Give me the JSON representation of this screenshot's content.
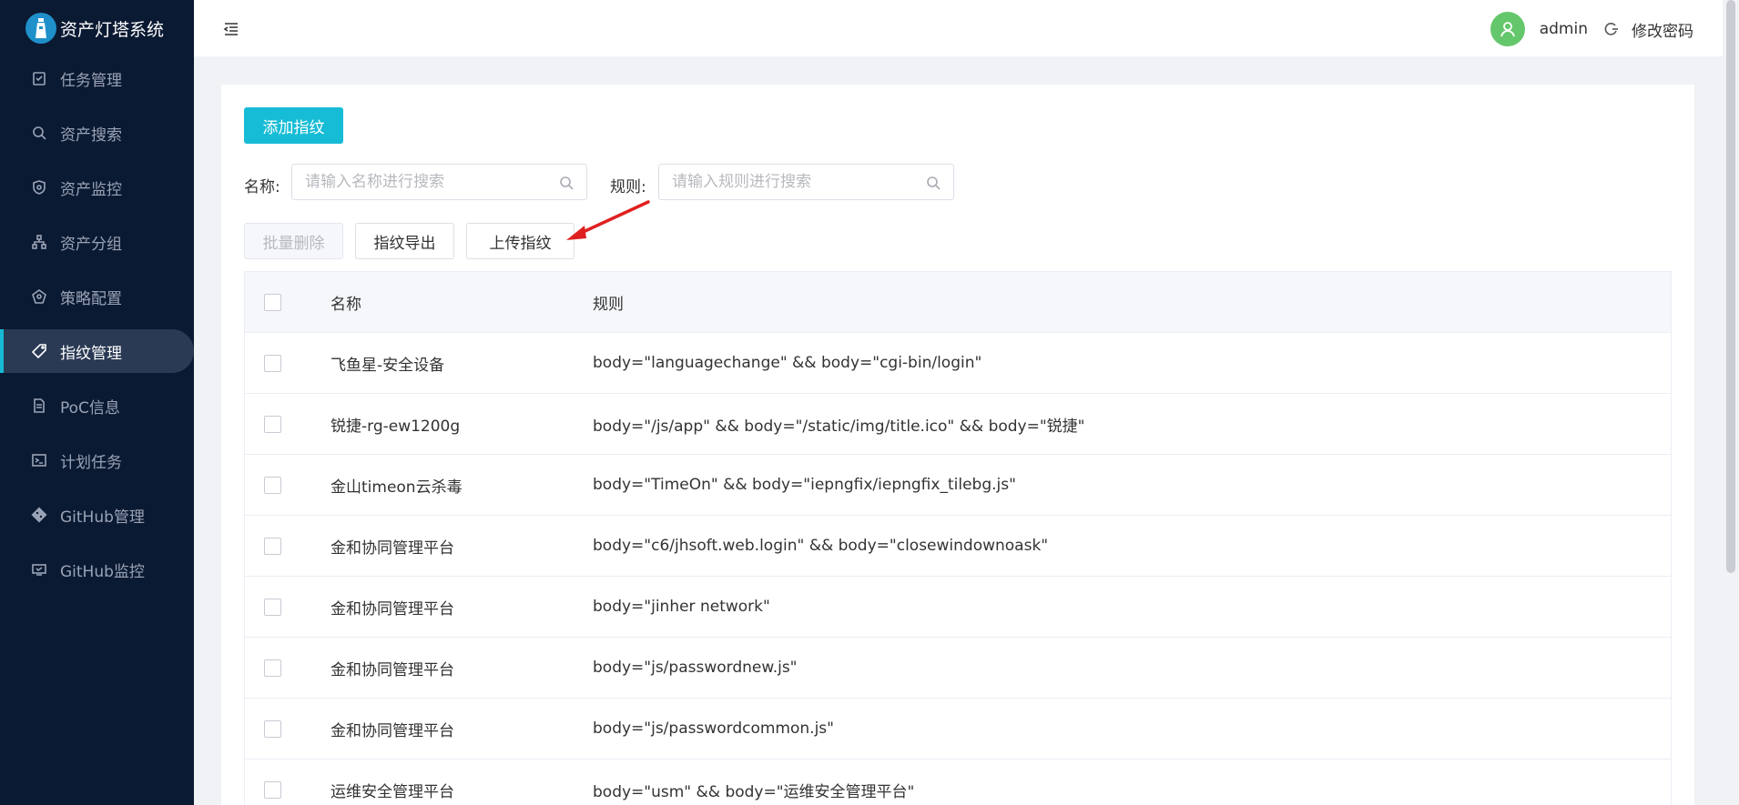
{
  "app": {
    "title": "资产灯塔系统"
  },
  "sidebar": {
    "items": [
      {
        "label": "任务管理",
        "icon": "task-icon",
        "active": false
      },
      {
        "label": "资产搜索",
        "icon": "search-icon",
        "active": false
      },
      {
        "label": "资产监控",
        "icon": "monitor-shield-icon",
        "active": false
      },
      {
        "label": "资产分组",
        "icon": "group-tree-icon",
        "active": false
      },
      {
        "label": "策略配置",
        "icon": "policy-icon",
        "active": false
      },
      {
        "label": "指纹管理",
        "icon": "tag-icon",
        "active": true
      },
      {
        "label": "PoC信息",
        "icon": "document-icon",
        "active": false
      },
      {
        "label": "计划任务",
        "icon": "terminal-icon",
        "active": false
      },
      {
        "label": "GitHub管理",
        "icon": "git-icon",
        "active": false
      },
      {
        "label": "GitHub监控",
        "icon": "screen-icon",
        "active": false
      }
    ]
  },
  "header": {
    "username": "admin",
    "change_password": "修改密码"
  },
  "toolbar": {
    "add_label": "添加指纹",
    "batch_delete_label": "批量删除",
    "export_label": "指纹导出",
    "upload_label": "上传指纹"
  },
  "filters": {
    "name_label": "名称:",
    "name_placeholder": "请输入名称进行搜索",
    "rule_label": "规则:",
    "rule_placeholder": "请输入规则进行搜索"
  },
  "table": {
    "columns": [
      "名称",
      "规则"
    ],
    "rows": [
      {
        "name": "飞鱼星-安全设备",
        "rule": "body=\"languagechange\" && body=\"cgi-bin/login\""
      },
      {
        "name": "锐捷-rg-ew1200g",
        "rule": "body=\"/js/app\" && body=\"/static/img/title.ico\" && body=\"锐捷\""
      },
      {
        "name": "金山timeon云杀毒",
        "rule": "body=\"TimeOn\" && body=\"iepngfix/iepngfix_tilebg.js\""
      },
      {
        "name": "金和协同管理平台",
        "rule": "body=\"c6/jhsoft.web.login\" && body=\"closewindownoask\""
      },
      {
        "name": "金和协同管理平台",
        "rule": "body=\"jinher network\""
      },
      {
        "name": "金和协同管理平台",
        "rule": "body=\"js/passwordnew.js\""
      },
      {
        "name": "金和协同管理平台",
        "rule": "body=\"js/passwordcommon.js\""
      },
      {
        "name": "运维安全管理平台",
        "rule": "body=\"usm\" && body=\"运维安全管理平台\""
      }
    ]
  },
  "colors": {
    "sidebar_bg": "#0b1a33",
    "accent": "#16bcd6",
    "avatar": "#65c76b",
    "annotation_arrow": "#e02020"
  }
}
